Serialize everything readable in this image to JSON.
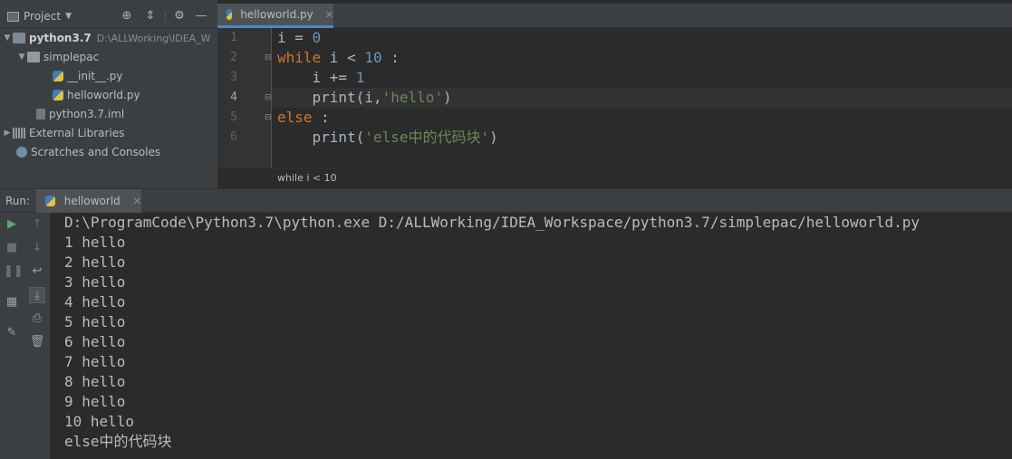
{
  "project_panel": {
    "title": "Project",
    "tree": [
      {
        "label": "python3.7",
        "path": "D:\\ALLWorking\\IDEA_W"
      },
      {
        "label": "simplepac"
      },
      {
        "label": "__init__.py"
      },
      {
        "label": "helloworld.py"
      },
      {
        "label": "python3.7.iml"
      },
      {
        "label": "External Libraries"
      },
      {
        "label": "Scratches and Consoles"
      }
    ]
  },
  "editor": {
    "tab_label": "helloworld.py",
    "line_numbers": [
      "1",
      "2",
      "3",
      "4",
      "5",
      "6"
    ],
    "lines": [
      [
        {
          "t": "i = ",
          "c": "plain"
        },
        {
          "t": "0",
          "c": "num"
        }
      ],
      [
        {
          "t": "while",
          "c": "kw"
        },
        {
          "t": " i < ",
          "c": "plain"
        },
        {
          "t": "10",
          "c": "num"
        },
        {
          "t": " :",
          "c": "plain"
        }
      ],
      [
        {
          "t": "    i += ",
          "c": "plain"
        },
        {
          "t": "1",
          "c": "num"
        }
      ],
      [
        {
          "t": "    print(i,",
          "c": "plain"
        },
        {
          "t": "'hello'",
          "c": "str"
        },
        {
          "t": ")",
          "c": "plain"
        }
      ],
      [
        {
          "t": "else",
          "c": "kw"
        },
        {
          "t": " :",
          "c": "plain"
        }
      ],
      [
        {
          "t": "    print(",
          "c": "plain"
        },
        {
          "t": "'else中的代码块'",
          "c": "str"
        },
        {
          "t": ")",
          "c": "plain"
        }
      ]
    ],
    "breadcrumb": "while i < 10"
  },
  "run_panel": {
    "label": "Run:",
    "tab_label": "helloworld",
    "output": [
      "D:\\ProgramCode\\Python3.7\\python.exe D:/ALLWorking/IDEA_Workspace/python3.7/simplepac/helloworld.py",
      "1 hello",
      "2 hello",
      "3 hello",
      "4 hello",
      "5 hello",
      "6 hello",
      "7 hello",
      "8 hello",
      "9 hello",
      "10 hello",
      "else中的代码块"
    ]
  },
  "icons": {
    "project_dropdown": "chevron-down-icon",
    "locate": "crosshair-icon",
    "collapse": "collapse-icon",
    "settings": "gear-icon",
    "hide": "minus-icon",
    "tab_close": "close-icon",
    "run": "play-icon",
    "stop": "stop-icon",
    "pause": "pause-icon",
    "up": "arrow-up-icon",
    "down": "arrow-down-icon",
    "soft_wrap": "wrap-icon",
    "scroll_end": "scroll-to-end-icon",
    "print": "print-icon",
    "trash": "trash-icon",
    "layout": "layout-icon",
    "pin": "pin-icon"
  },
  "colors": {
    "keyword": "#cc7832",
    "number": "#6897bb",
    "string": "#6a8759",
    "text": "#a9b7c6",
    "run_green": "#59a869"
  }
}
